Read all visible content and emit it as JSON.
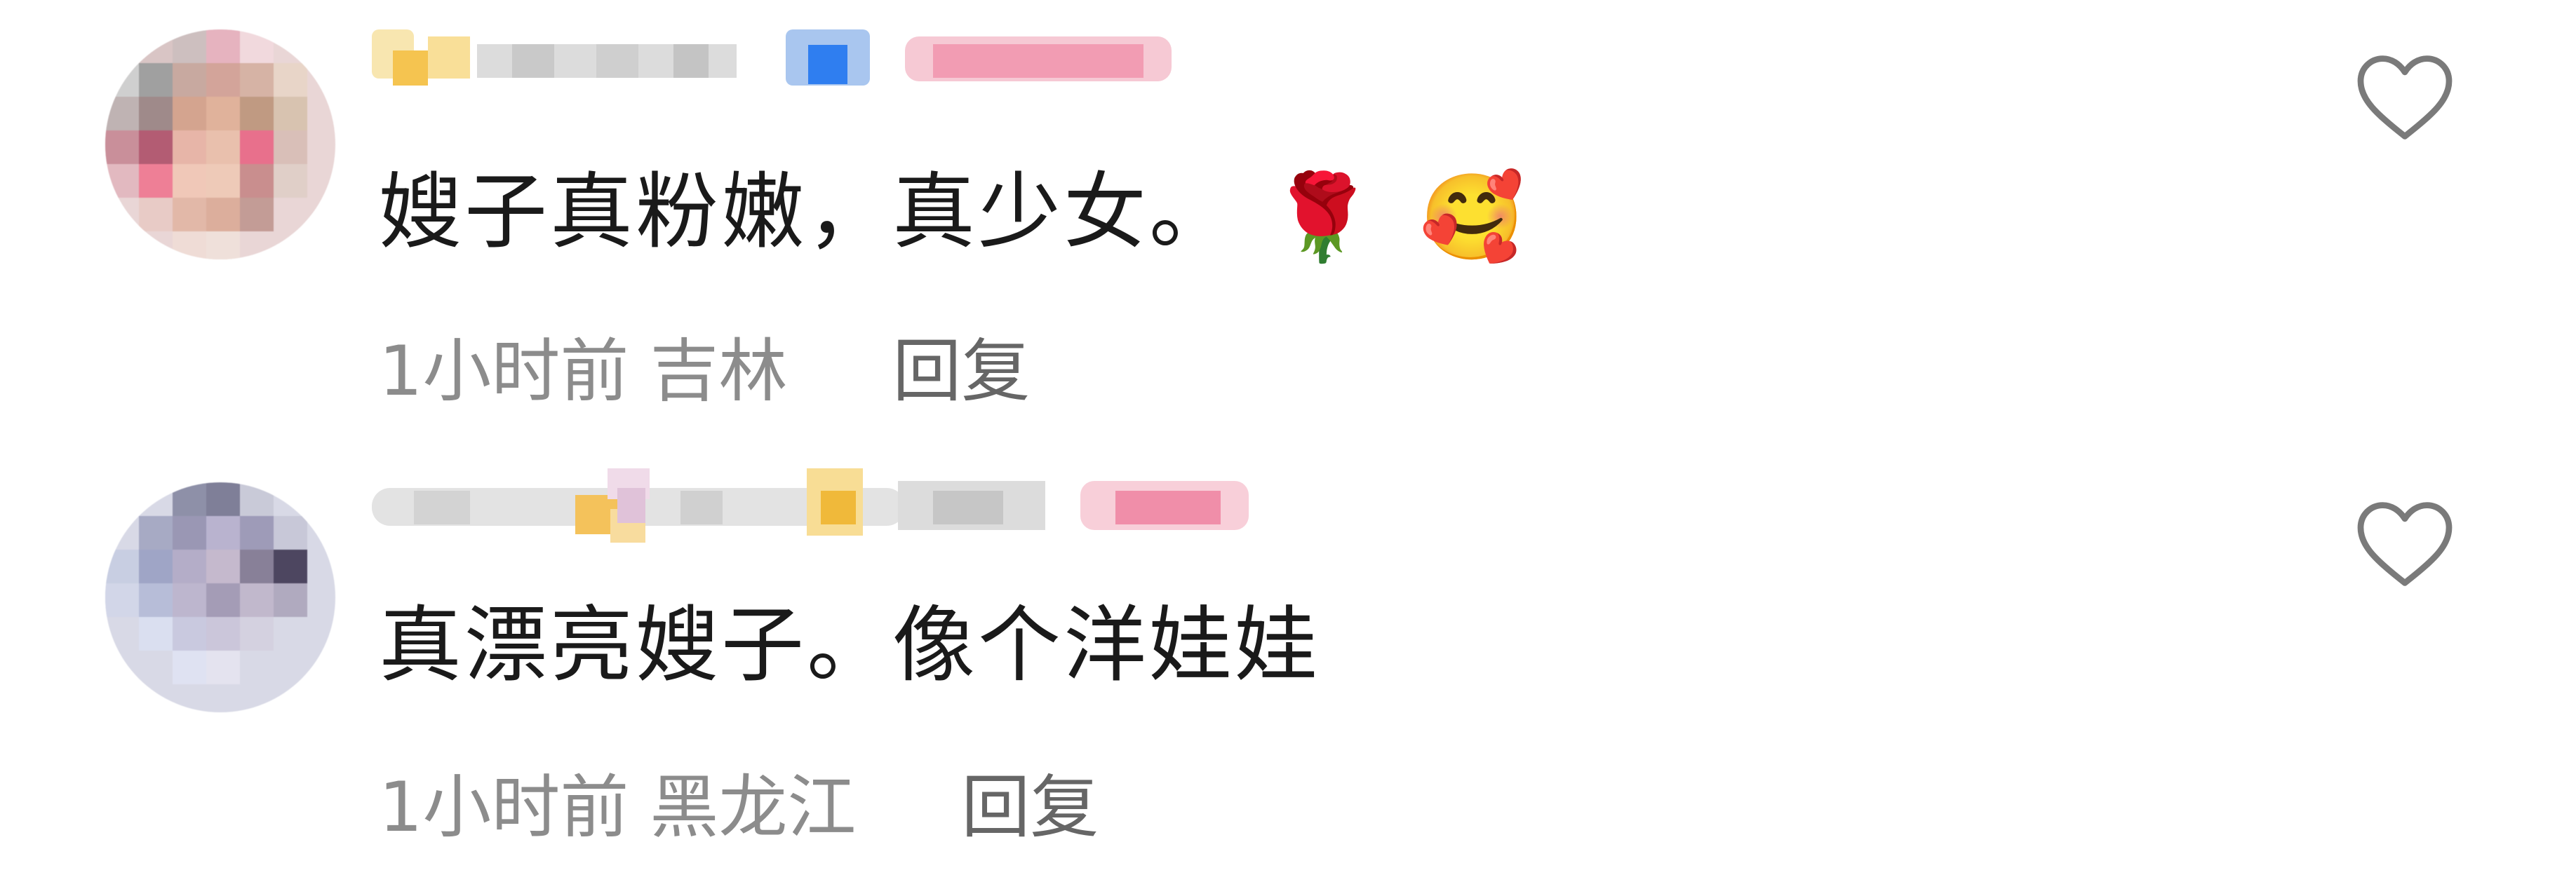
{
  "comments": [
    {
      "avatar": "blurred-avatar-pink",
      "username": "",
      "text": "嫂子真粉嫩，真少女。",
      "emojis": [
        "🌹",
        "🥰"
      ],
      "time": "1小时前",
      "location": "吉林",
      "reply_label": "回复",
      "like_icon": "heart-outline-icon"
    },
    {
      "avatar": "blurred-avatar-purple",
      "username": "",
      "text": "真漂亮嫂子。像个洋娃娃",
      "emojis": [],
      "time": "1小时前",
      "location": "黑龙江",
      "reply_label": "回复",
      "like_icon": "heart-outline-icon"
    }
  ],
  "colors": {
    "text_primary": "#1a1a1a",
    "text_meta": "#8c8c8c",
    "reply_text": "#666666",
    "heart_stroke": "#7a7a7a",
    "background": "#ffffff"
  }
}
